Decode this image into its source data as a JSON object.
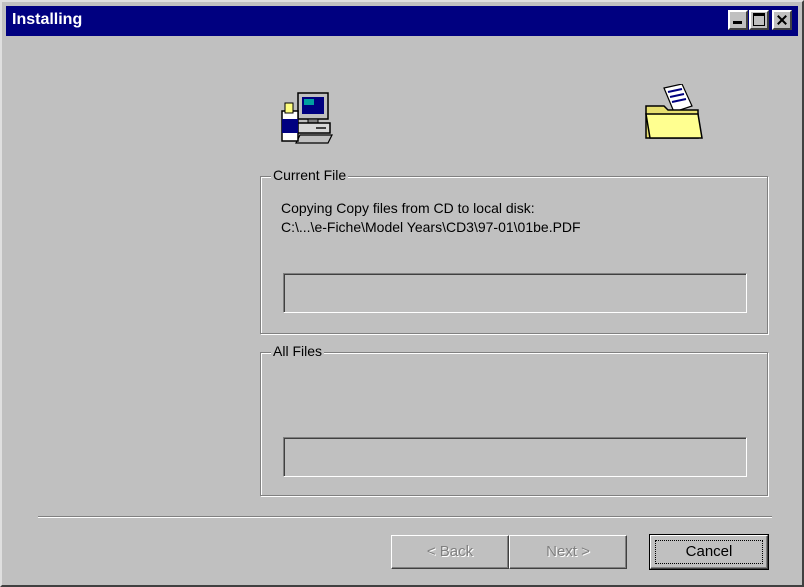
{
  "window": {
    "title": "Installing"
  },
  "titlebar_buttons": {
    "minimize_icon": "minimize-icon",
    "maximize_icon": "maximize-icon",
    "close_icon": "close-icon"
  },
  "icons": {
    "setup": "computer-setup-icon",
    "folder": "folder-icon"
  },
  "current_file": {
    "legend": "Current File",
    "line1": "Copying Copy files from CD to local disk:",
    "line2": "C:\\...\\e-Fiche\\Model Years\\CD3\\97-01\\01be.PDF",
    "progress": 0
  },
  "all_files": {
    "legend": "All Files",
    "progress": 0
  },
  "buttons": {
    "back": "< Back",
    "next": "Next >",
    "cancel": "Cancel"
  },
  "colors": {
    "titlebar": "#000080",
    "face": "#c0c0c0"
  }
}
